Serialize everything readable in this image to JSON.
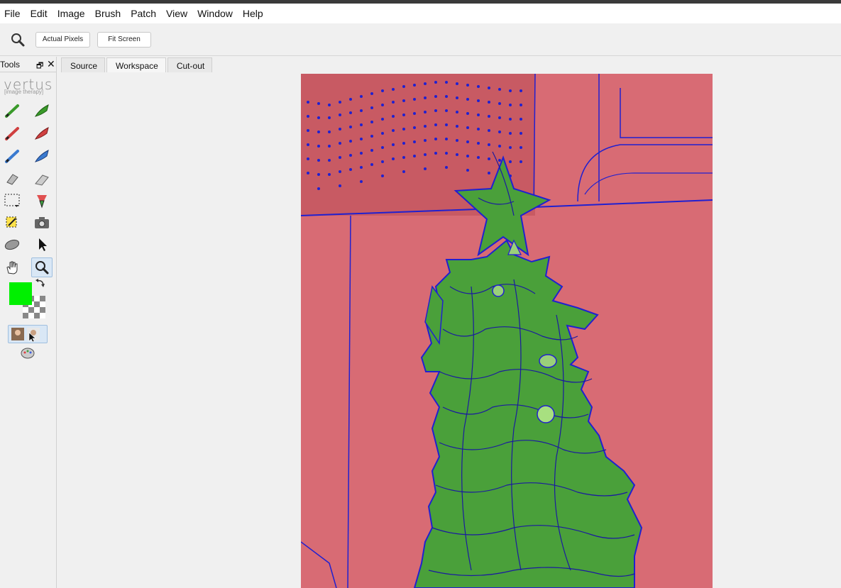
{
  "menu": [
    "File",
    "Edit",
    "Image",
    "Brush",
    "Patch",
    "View",
    "Window",
    "Help"
  ],
  "toolbar": {
    "zoom_icon": "magnifier-icon",
    "actual_pixels_label": "Actual Pixels",
    "fit_screen_label": "Fit Screen"
  },
  "tools_panel": {
    "title": "Tools",
    "restore_glyph": "🗗",
    "close_glyph": "✕",
    "logo_text": "vertus",
    "logo_subtitle": "[image therapy]",
    "foreground_color": "#00f000"
  },
  "tabs": [
    {
      "label": "Source",
      "selected": false
    },
    {
      "label": "Workspace",
      "selected": true
    },
    {
      "label": "Cut-out",
      "selected": false
    }
  ],
  "overlay_colors": {
    "background_mask": "#d86b74",
    "foreground_mask": "#4aa03a",
    "edge_lines": "#2020d0"
  }
}
